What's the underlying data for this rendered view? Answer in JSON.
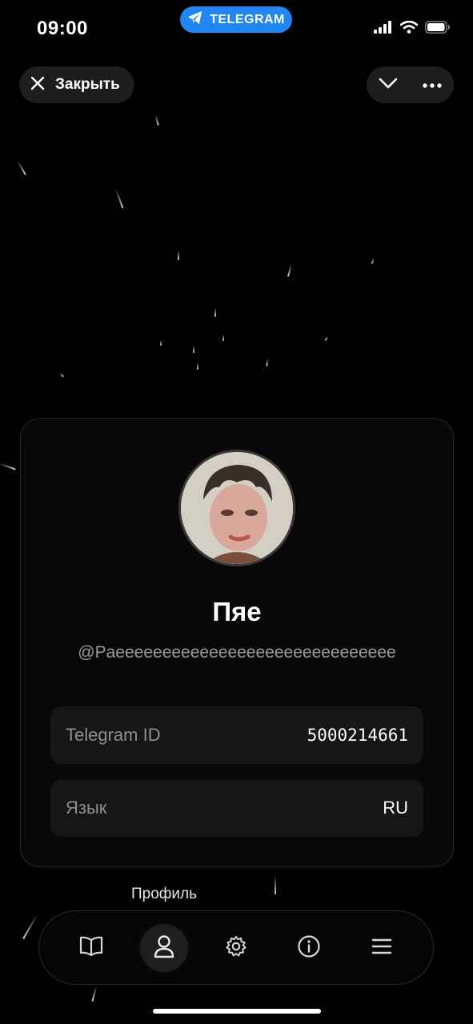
{
  "status_bar": {
    "time": "09:00",
    "app_pill_label": "TELEGRAM",
    "app_pill_color": "#1f86f2"
  },
  "top_bar": {
    "close_label": "Закрыть",
    "close_icon": "close-icon",
    "collapse_icon": "chevron-down-icon",
    "more_icon": "more-dots-icon"
  },
  "profile": {
    "name": "Пяе",
    "username": "@Paeeeeeeeeeeeeeeeeeeeeeeeeeeeeee",
    "rows": [
      {
        "label": "Telegram ID",
        "value": "5000214661"
      },
      {
        "label": "Язык",
        "value": "RU"
      }
    ]
  },
  "bottom_nav": {
    "active_tooltip": "Профиль",
    "items": [
      {
        "name": "book-icon"
      },
      {
        "name": "profile-icon",
        "active": true
      },
      {
        "name": "gear-icon"
      },
      {
        "name": "info-icon"
      },
      {
        "name": "menu-icon"
      }
    ]
  }
}
